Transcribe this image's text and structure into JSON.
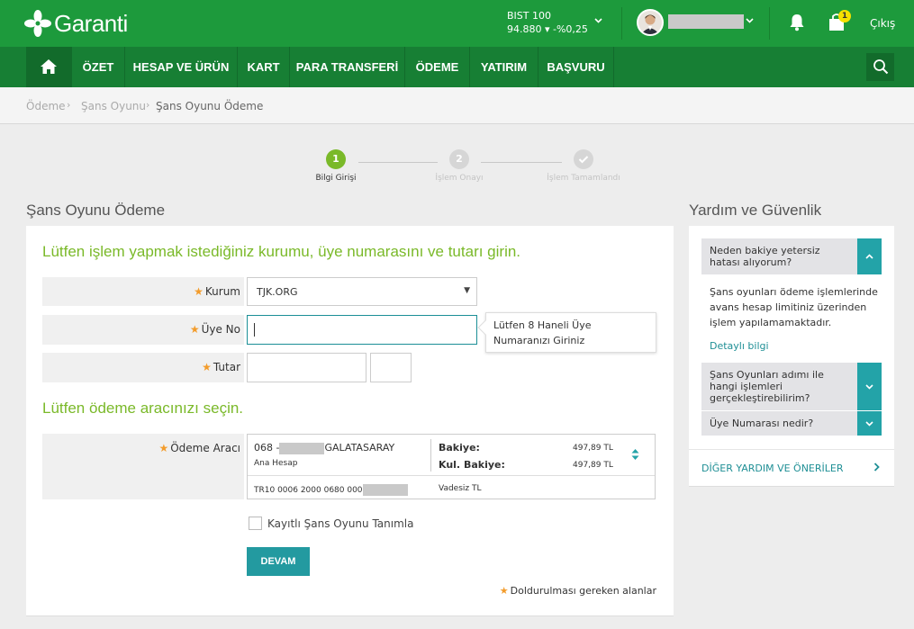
{
  "header": {
    "logo_text": "Garanti",
    "bist_label": "BIST 100",
    "bist_value": "94.880 ▾ -%0,25",
    "badge_count": "1",
    "logout": "Çıkış"
  },
  "nav": {
    "items": [
      "ÖZET",
      "HESAP VE ÜRÜN",
      "KART",
      "PARA TRANSFERİ",
      "ÖDEME",
      "YATIRIM",
      "BAŞVURU"
    ]
  },
  "breadcrumb": {
    "items": [
      "Ödeme",
      "Şans Oyunu",
      "Şans Oyunu Ödeme"
    ]
  },
  "stepper": {
    "steps": [
      {
        "num": "1",
        "label": "Bilgi Girişi"
      },
      {
        "num": "2",
        "label": "İşlem Onayı"
      },
      {
        "num": "",
        "label": "İşlem Tamamlandı"
      }
    ]
  },
  "page_title": "Şans Oyunu Ödeme",
  "form": {
    "intro": "Lütfen işlem yapmak istediğiniz kurumu, üye numarasını ve tutarı girin.",
    "kurum_label": "Kurum",
    "kurum_value": "TJK.ORG",
    "uye_label": "Üye No",
    "uye_value": "",
    "tooltip": "Lütfen 8 Haneli Üye Numaranızı Giriniz",
    "tutar_label": "Tutar",
    "tutar_value": "",
    "tutar_decimal": "",
    "pay_title": "Lütfen ödeme aracınızı seçin.",
    "odeme_label": "Ödeme Aracı",
    "account": {
      "number_prefix": "068 -",
      "branch": "GALATASARAY",
      "type": "Ana Hesap",
      "balance_label": "Bakiye:",
      "balance": "497,89 TL",
      "usable_label": "Kul. Bakiye:",
      "usable": "497,89 TL",
      "iban_prefix": "TR10 0006 2000 0680 000",
      "term": "Vadesiz TL"
    },
    "checkbox_label": "Kayıtlı Şans Oyunu Tanımla",
    "submit": "DEVAM",
    "required_note": "Doldurulması gereken alanlar"
  },
  "help": {
    "title": "Yardım ve Güvenlik",
    "q1": "Neden bakiye yetersiz hatası alıyorum?",
    "a1": "Şans oyunları ödeme işlemlerinde avans hesap limitiniz üzerinden işlem yapılamamaktadır.",
    "a1_link": "Detaylı bilgi",
    "q2": "Şans Oyunları adımı ile hangi işlemleri gerçekleştirebilirim?",
    "q3": "Üye Numarası nedir?",
    "footer": "DİĞER YARDIM VE ÖNERİLER"
  }
}
